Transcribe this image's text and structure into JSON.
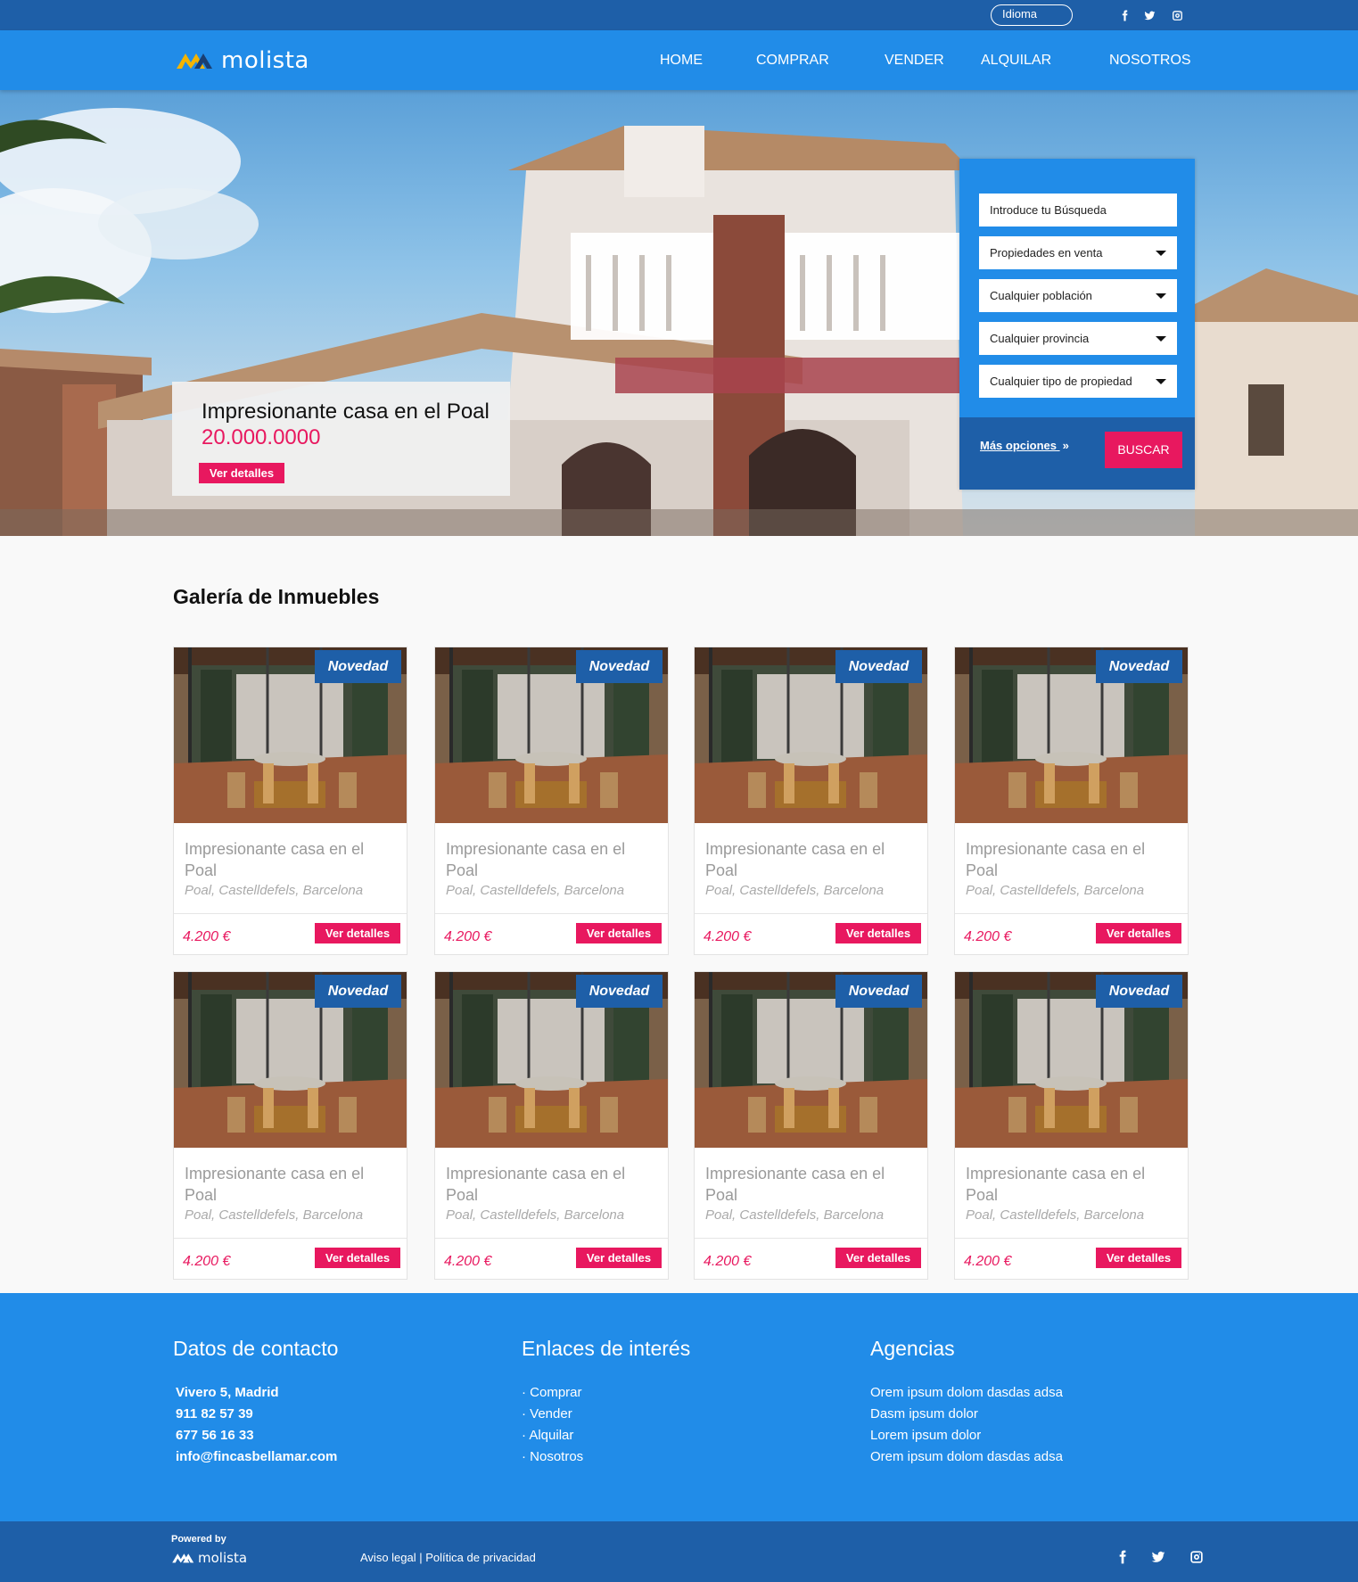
{
  "topbar": {
    "language_label": "Idioma",
    "social": [
      "facebook-icon",
      "twitter-icon",
      "instagram-icon"
    ]
  },
  "brand": {
    "name": "molista"
  },
  "nav": {
    "items": [
      "HOME",
      "COMPRAR",
      "VENDER",
      "ALQUILAR",
      "NOSOTROS"
    ]
  },
  "hero": {
    "title": "Impresionante casa en el Poal",
    "price": "20.000.0000",
    "button": "Ver detalles"
  },
  "search": {
    "query_placeholder": "Introduce tu Búsqueda",
    "selects": [
      "Propiedades en venta",
      "Cualquier población",
      "Cualquier provincia",
      "Cualquier tipo de propiedad"
    ],
    "more_options": "Más opciones",
    "submit": "BUSCAR"
  },
  "gallery": {
    "title": "Galería de Inmuebles",
    "listings": [
      {
        "badge": "Novedad",
        "title": "Impresionante casa en el Poal",
        "location": "Poal, Castelldefels, Barcelona",
        "price": "4.200 €",
        "button": "Ver detalles"
      },
      {
        "badge": "Novedad",
        "title": "Impresionante casa en el Poal",
        "location": "Poal, Castelldefels, Barcelona",
        "price": "4.200 €",
        "button": "Ver detalles"
      },
      {
        "badge": "Novedad",
        "title": "Impresionante casa en el Poal",
        "location": "Poal, Castelldefels, Barcelona",
        "price": "4.200 €",
        "button": "Ver detalles"
      },
      {
        "badge": "Novedad",
        "title": "Impresionante casa en el Poal",
        "location": "Poal, Castelldefels, Barcelona",
        "price": "4.200 €",
        "button": "Ver detalles"
      },
      {
        "badge": "Novedad",
        "title": "Impresionante casa en el Poal",
        "location": "Poal, Castelldefels, Barcelona",
        "price": "4.200 €",
        "button": "Ver detalles"
      },
      {
        "badge": "Novedad",
        "title": "Impresionante casa en el Poal",
        "location": "Poal, Castelldefels, Barcelona",
        "price": "4.200 €",
        "button": "Ver detalles"
      },
      {
        "badge": "Novedad",
        "title": "Impresionante casa en el Poal",
        "location": "Poal, Castelldefels, Barcelona",
        "price": "4.200 €",
        "button": "Ver detalles"
      },
      {
        "badge": "Novedad",
        "title": "Impresionante casa en el Poal",
        "location": "Poal, Castelldefels, Barcelona",
        "price": "4.200 €",
        "button": "Ver detalles"
      }
    ]
  },
  "footer": {
    "contact": {
      "title": "Datos de contacto",
      "lines": [
        "Vivero 5, Madrid",
        "911 82 57 39",
        "677 56 16 33",
        "info@fincasbellamar.com"
      ]
    },
    "links": {
      "title": "Enlaces de interés",
      "items": [
        "· Comprar",
        "· Vender",
        "· Alquilar",
        "· Nosotros"
      ]
    },
    "agencies": {
      "title": "Agencias",
      "items": [
        "Orem ipsum dolom dasdas adsa",
        "Dasm ipsum dolor",
        "Lorem ipsum dolor",
        "Orem ipsum dolom dasdas adsa"
      ]
    },
    "bottom": {
      "powered_by": "Powered by",
      "brand": "molista",
      "legal": "Aviso legal",
      "separator": " | ",
      "privacy": "Política de privacidad",
      "social": [
        "facebook-icon",
        "twitter-icon",
        "instagram-icon"
      ]
    }
  },
  "colors": {
    "topbar": "#1e5fa8",
    "nav": "#218ce8",
    "accent": "#e8185f",
    "badge": "#1e5fa8",
    "logo_mark": "#f4b400"
  }
}
